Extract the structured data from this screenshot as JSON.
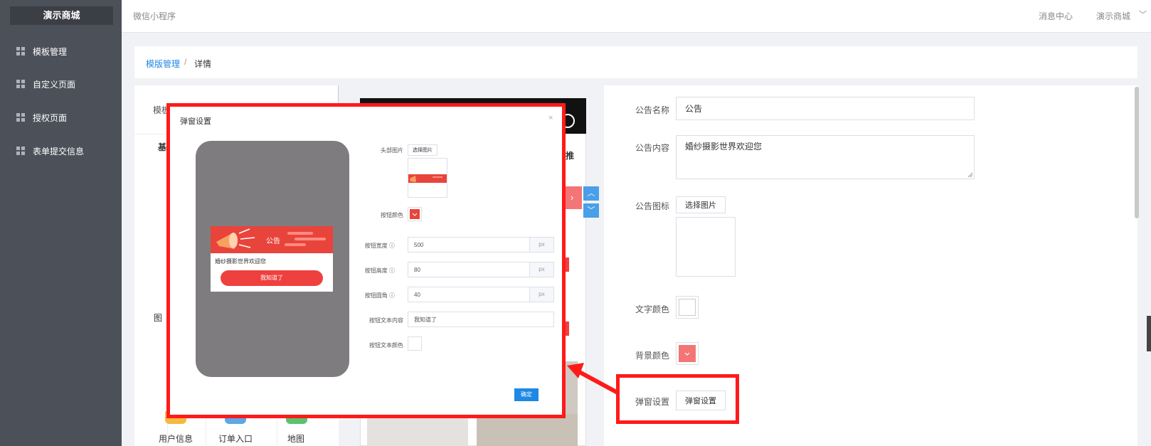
{
  "sidebar": {
    "brand": "演示商城",
    "items": [
      {
        "label": "模板管理"
      },
      {
        "label": "自定义页面"
      },
      {
        "label": "授权页面"
      },
      {
        "label": "表单提交信息"
      }
    ]
  },
  "header": {
    "app_name": "微信小程序",
    "messages": "消息中心",
    "user": "演示商城",
    "user_chevron": "﹀"
  },
  "breadcrumb": {
    "parent": "模版管理",
    "separator": "/",
    "current": "详情"
  },
  "left_panel": {
    "label_truncated": "模板",
    "tab_truncated": "基",
    "side_text": "图",
    "bottom_labels": [
      "用户信息",
      "订单入口",
      "地图"
    ]
  },
  "phone_preview": {
    "title_fragment": "推",
    "arrow_right": "›",
    "up_icon": "︿",
    "down_icon": "﹀"
  },
  "form": {
    "name_label": "公告名称",
    "name_value": "公告",
    "content_label": "公告内容",
    "content_value": "婚纱摄影世界欢迎您",
    "icon_label": "公告图标",
    "icon_button": "选择图片",
    "text_color_label": "文字颜色",
    "bg_color_label": "背景颜色",
    "popup_label": "弹窗设置",
    "popup_button": "弹窗设置",
    "colors": {
      "text": "#ffffff",
      "bg": "#f47575"
    }
  },
  "modal": {
    "title": "弹窗设置",
    "close": "×",
    "popup_title": "公告",
    "popup_text": "婚纱摄影世界欢迎您",
    "popup_button": "我知道了",
    "fields": {
      "header_image_label": "头部图片",
      "header_image_button": "选择图片",
      "button_color_label": "按钮颜色",
      "button_width_label": "按钮宽度",
      "button_width_value": "500",
      "button_height_label": "按钮高度",
      "button_height_value": "80",
      "button_radius_label": "按钮圆角",
      "button_radius_value": "40",
      "unit": "px",
      "button_text_label": "按钮文本内容",
      "button_text_value": "我知道了",
      "button_text_color_label": "按钮文本颜色"
    },
    "confirm": "确定",
    "colors": {
      "button": "#e8443c",
      "text": "#ffffff"
    }
  }
}
